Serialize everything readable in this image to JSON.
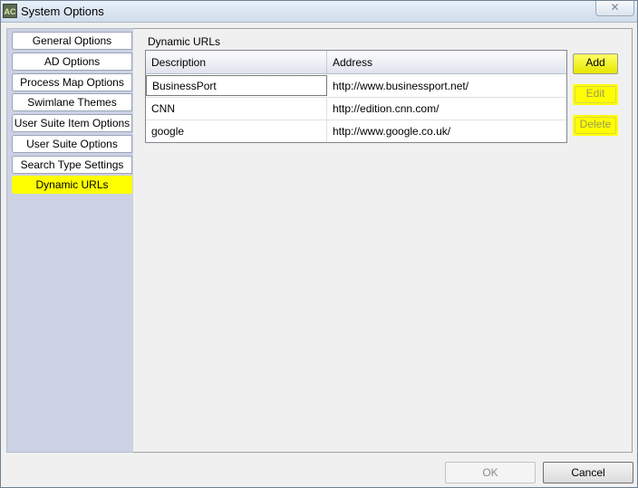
{
  "window": {
    "title": "System Options",
    "icon_text": "AC",
    "close_glyph": "✕"
  },
  "sidebar": {
    "items": [
      {
        "label": "General Options"
      },
      {
        "label": "AD Options"
      },
      {
        "label": "Process Map Options"
      },
      {
        "label": "Swimlane Themes"
      },
      {
        "label": "User Suite Item Options"
      },
      {
        "label": "User Suite Options"
      },
      {
        "label": "Search Type Settings"
      },
      {
        "label": "Dynamic URLs",
        "selected": true
      }
    ]
  },
  "panel": {
    "group_label": "Dynamic URLs",
    "columns": [
      "Description",
      "Address"
    ],
    "rows": [
      {
        "description": "BusinessPort",
        "address": "http://www.businessport.net/"
      },
      {
        "description": "CNN",
        "address": "http://edition.cnn.com/"
      },
      {
        "description": "google",
        "address": "http://www.google.co.uk/"
      }
    ],
    "buttons": {
      "add": "Add",
      "edit": "Edit",
      "delete": "Delete"
    }
  },
  "footer": {
    "ok": "OK",
    "cancel": "Cancel"
  },
  "colors": {
    "highlight": "#ffff00",
    "sidebar_bg": "#ccd2e4",
    "title_gradient_top": "#e9f1fa"
  }
}
